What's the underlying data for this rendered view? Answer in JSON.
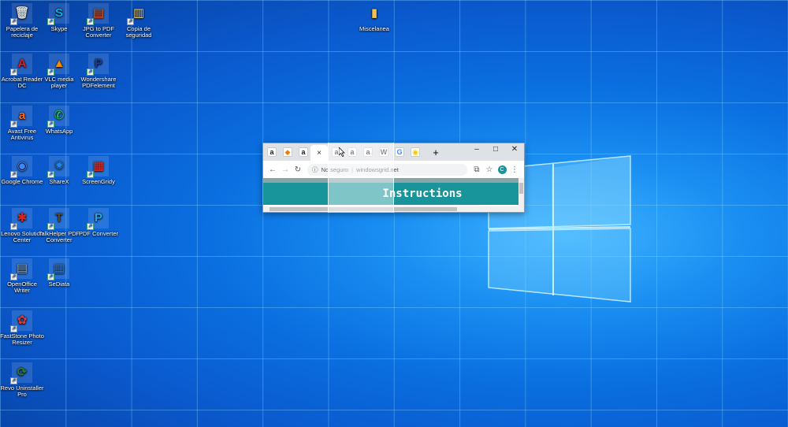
{
  "desktop": {
    "icons": [
      {
        "label": "Papelera de reciclaje",
        "icon": "recycle-bin-icon",
        "color": "#cfd8dc"
      },
      {
        "label": "Skype",
        "icon": "skype-icon",
        "color": "#00aff0"
      },
      {
        "label": "JPG to PDF Converter",
        "icon": "jpg-to-pdf-icon",
        "color": "#e8612c"
      },
      {
        "label": "Copia de seguridad",
        "icon": "backup-folder-icon",
        "color": "#f2d27a"
      },
      {
        "label": "Miscelanea",
        "icon": "folder-icon",
        "color": "#f0c44c"
      },
      {
        "label": "Acrobat Reader DC",
        "icon": "acrobat-icon",
        "color": "#d8202b"
      },
      {
        "label": "VLC media player",
        "icon": "vlc-icon",
        "color": "#f48b00"
      },
      {
        "label": "Wondershare PDFelement",
        "icon": "pdfelement-icon",
        "color": "#1d3c8f"
      },
      {
        "label": "Avast Free Antivirus",
        "icon": "avast-icon",
        "color": "#f26c1d"
      },
      {
        "label": "WhatsApp",
        "icon": "whatsapp-icon",
        "color": "#25d366"
      },
      {
        "label": "Google Chrome",
        "icon": "chrome-icon",
        "color": "#4285f4"
      },
      {
        "label": "ShareX",
        "icon": "sharex-icon",
        "color": "#1e88e5"
      },
      {
        "label": "ScreenGridy",
        "icon": "screengridy-icon",
        "color": "#e53935"
      },
      {
        "label": "Lenovo Solution Center",
        "icon": "lenovo-icon",
        "color": "#e2231a"
      },
      {
        "label": "TalkHelper PDF Converter",
        "icon": "talkhelper-icon",
        "color": "#5d4a2b"
      },
      {
        "label": "PDF Converter",
        "icon": "pdf-converter-icon",
        "color": "#2aa6df"
      },
      {
        "label": "OpenOffice Writer",
        "icon": "openoffice-writer-icon",
        "color": "#8ea6bf"
      },
      {
        "label": "SeDiata",
        "icon": "sediata-icon",
        "color": "#3b79c4"
      },
      {
        "label": "FastStone Photo Resizer",
        "icon": "faststone-icon",
        "color": "#e53935"
      },
      {
        "label": "Revo Uninstaller Pro",
        "icon": "revo-icon",
        "color": "#2e7d32"
      }
    ]
  },
  "browser": {
    "tabs": [
      {
        "icon": "amazon-icon",
        "glyph": "a",
        "color": "#1a1a1a"
      },
      {
        "icon": "diamond-icon",
        "glyph": "◆",
        "color": "#f57c00"
      },
      {
        "icon": "amazon-icon",
        "glyph": "a",
        "color": "#1a1a1a"
      },
      {
        "icon": "amazon-icon",
        "glyph": "a",
        "color": "#1a1a1a"
      },
      {
        "icon": "amazon-icon",
        "glyph": "a",
        "color": "#1a1a1a"
      },
      {
        "icon": "amazon-icon",
        "glyph": "a",
        "color": "#1a1a1a"
      },
      {
        "icon": "wikipedia-icon",
        "glyph": "W",
        "color": "#333333"
      },
      {
        "icon": "google-icon",
        "glyph": "G",
        "color": "#4285f4"
      },
      {
        "icon": "shell-icon",
        "glyph": "◉",
        "color": "#f7c600"
      }
    ],
    "active_tab_close": "×",
    "new_tab": "+",
    "minimize": "–",
    "maximize": "□",
    "close": "✕",
    "url_prefix": "No seguro",
    "url": "windowsgrid.net",
    "account_initial": "C",
    "page_heading": "Instructions",
    "accent": "#17959a"
  }
}
